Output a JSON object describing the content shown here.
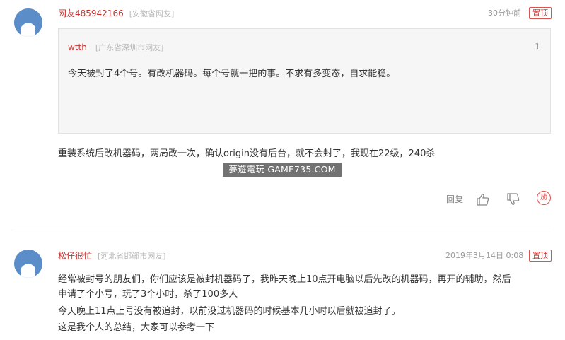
{
  "comments": [
    {
      "user": "网友485942166",
      "location": "[安徽省网友]",
      "time": "30分钟前",
      "top_label": "置顶",
      "quote": {
        "user": "wtth",
        "location": "[广东省深圳市网友]",
        "floor": "1",
        "text": "今天被封了4个号。有改机器码。每个号就一把的事。不求有多变态，自求能稳。"
      },
      "body": "重装系统后改机器码，两局改一次，确认origin没有后台，就不会封了，我现在22级，240杀",
      "actions": {
        "reply": "回复",
        "report": "劢"
      }
    },
    {
      "user": "松仔很忙",
      "location": "[河北省邯郸市网友]",
      "time": "2019年3月14日 0:08",
      "top_label": "置顶",
      "body_lines": [
        "经常被封号的朋友们，你们应该是被封机器码了，我昨天晚上10点开电脑以后先改的机器码，再开的辅助，然后",
        "申请了个小号，玩了3个小时，杀了100多人",
        "今天晚上11点上号没有被追封，以前没过机器码的时候基本几小时以后就被追封了。",
        "这是我个人的总结，大家可以参考一下"
      ]
    }
  ],
  "watermark": "夢遊電玩 GAME735.COM",
  "icons": [
    "avatar-icon",
    "thumbs-up-icon",
    "thumbs-down-icon",
    "report-icon"
  ],
  "colors": {
    "accent": "#c9322e",
    "avatar": "#5b8dc9",
    "quote_bg": "#f6f6f6"
  }
}
